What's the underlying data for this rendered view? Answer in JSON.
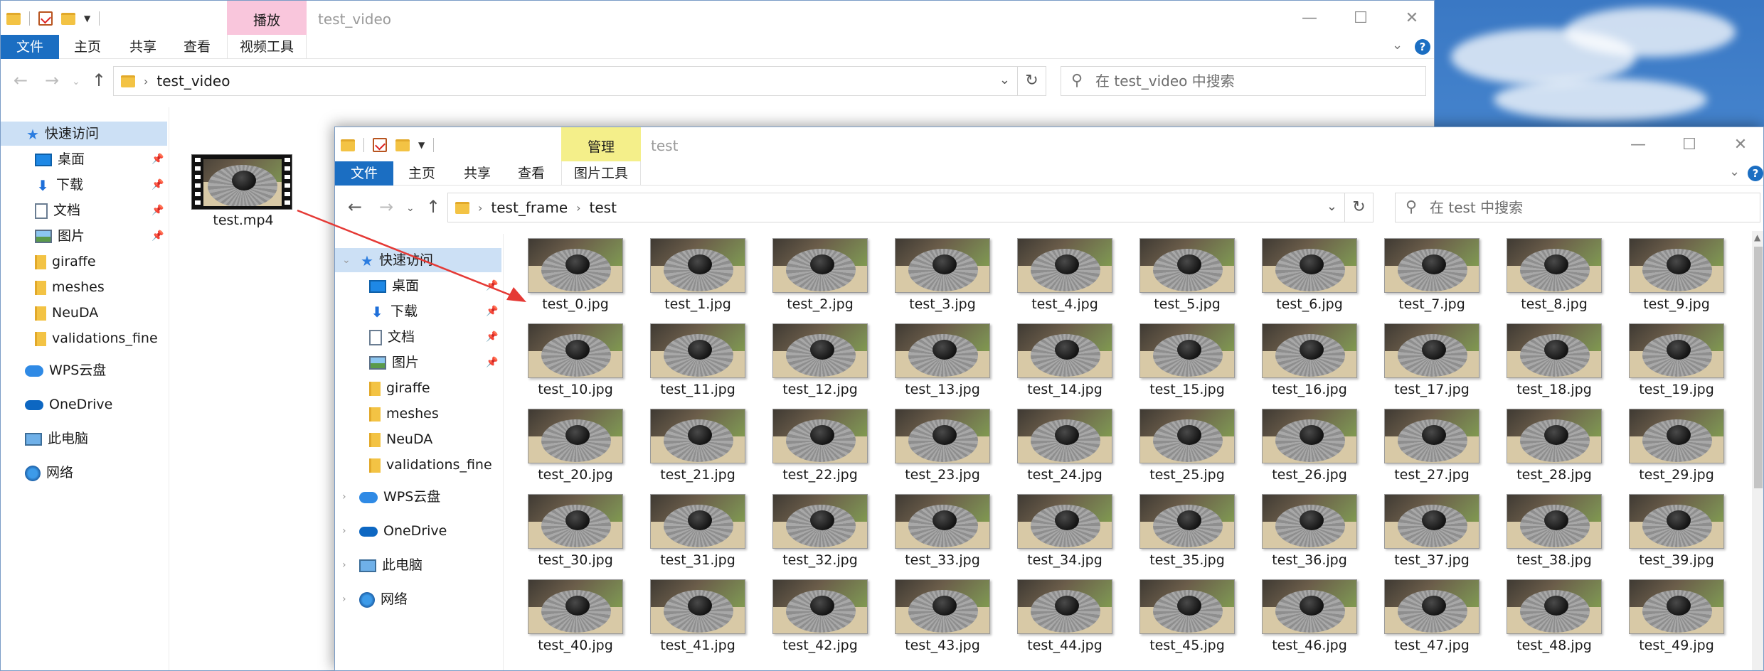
{
  "back_window": {
    "title": "test_video",
    "context_tab": {
      "header": "播放",
      "label": "视频工具",
      "color": "#f9c6dc"
    },
    "ribbon_tabs": [
      "文件",
      "主页",
      "共享",
      "查看"
    ],
    "address": {
      "path": [
        "test_video"
      ]
    },
    "search_placeholder": "在 test_video 中搜索",
    "nav": [
      {
        "label": "快速访问",
        "icon": "star-icon",
        "selected": true
      },
      {
        "label": "桌面",
        "icon": "desktop-icon",
        "pinned": true
      },
      {
        "label": "下载",
        "icon": "download-icon",
        "pinned": true
      },
      {
        "label": "文档",
        "icon": "document-icon",
        "pinned": true
      },
      {
        "label": "图片",
        "icon": "pictures-icon",
        "pinned": true
      },
      {
        "label": "giraffe",
        "icon": "folder-icon"
      },
      {
        "label": "meshes",
        "icon": "folder-icon"
      },
      {
        "label": "NeuDA",
        "icon": "folder-icon"
      },
      {
        "label": "validations_fine",
        "icon": "folder-icon"
      },
      {
        "label": "WPS云盘",
        "icon": "cloud-icon"
      },
      {
        "label": "OneDrive",
        "icon": "onedrive-icon"
      },
      {
        "label": "此电脑",
        "icon": "computer-icon"
      },
      {
        "label": "网络",
        "icon": "network-icon"
      }
    ],
    "files": [
      {
        "name": "test.mp4",
        "icon": "video-thumbnail"
      }
    ]
  },
  "front_window": {
    "title": "test",
    "context_tab": {
      "header": "管理",
      "label": "图片工具",
      "color": "#f4ef8a"
    },
    "ribbon_tabs": [
      "文件",
      "主页",
      "共享",
      "查看"
    ],
    "address": {
      "path": [
        "test_frame",
        "test"
      ]
    },
    "search_placeholder": "在 test 中搜索",
    "nav": [
      {
        "label": "快速访问",
        "icon": "star-icon",
        "selected": true
      },
      {
        "label": "桌面",
        "icon": "desktop-icon",
        "pinned": true
      },
      {
        "label": "下载",
        "icon": "download-icon",
        "pinned": true
      },
      {
        "label": "文档",
        "icon": "document-icon",
        "pinned": true
      },
      {
        "label": "图片",
        "icon": "pictures-icon",
        "pinned": true
      },
      {
        "label": "giraffe",
        "icon": "folder-icon"
      },
      {
        "label": "meshes",
        "icon": "folder-icon"
      },
      {
        "label": "NeuDA",
        "icon": "folder-icon"
      },
      {
        "label": "validations_fine",
        "icon": "folder-icon"
      },
      {
        "label": "WPS云盘",
        "icon": "cloud-icon"
      },
      {
        "label": "OneDrive",
        "icon": "onedrive-icon"
      },
      {
        "label": "此电脑",
        "icon": "computer-icon"
      },
      {
        "label": "网络",
        "icon": "network-icon"
      }
    ],
    "files": [
      "test_0.jpg",
      "test_1.jpg",
      "test_2.jpg",
      "test_3.jpg",
      "test_4.jpg",
      "test_5.jpg",
      "test_6.jpg",
      "test_7.jpg",
      "test_8.jpg",
      "test_9.jpg",
      "test_10.jpg",
      "test_11.jpg",
      "test_12.jpg",
      "test_13.jpg",
      "test_14.jpg",
      "test_15.jpg",
      "test_16.jpg",
      "test_17.jpg",
      "test_18.jpg",
      "test_19.jpg",
      "test_20.jpg",
      "test_21.jpg",
      "test_22.jpg",
      "test_23.jpg",
      "test_24.jpg",
      "test_25.jpg",
      "test_26.jpg",
      "test_27.jpg",
      "test_28.jpg",
      "test_29.jpg",
      "test_30.jpg",
      "test_31.jpg",
      "test_32.jpg",
      "test_33.jpg",
      "test_34.jpg",
      "test_35.jpg",
      "test_36.jpg",
      "test_37.jpg",
      "test_38.jpg",
      "test_39.jpg",
      "test_40.jpg",
      "test_41.jpg",
      "test_42.jpg",
      "test_43.jpg",
      "test_44.jpg",
      "test_45.jpg",
      "test_46.jpg",
      "test_47.jpg",
      "test_48.jpg",
      "test_49.jpg"
    ]
  },
  "colors": {
    "accent": "#1b6ec2",
    "selection": "#cce0f5",
    "annotation_arrow": "#e53935"
  }
}
